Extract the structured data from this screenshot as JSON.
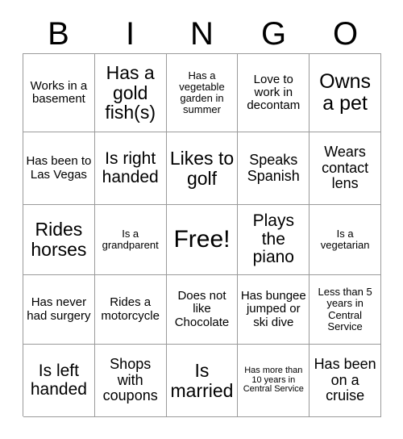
{
  "card": {
    "header_letters": [
      "B",
      "I",
      "N",
      "G",
      "O"
    ],
    "grid": {
      "rows": 5,
      "columns": 5,
      "border_color": "#9a9a9a",
      "background_color": "#ffffff",
      "text_color": "#000000"
    },
    "cells": [
      {
        "text": "Works in a basement",
        "size": "fs-sm",
        "column": "B",
        "row": 1
      },
      {
        "text": "Has a gold fish(s)",
        "size": "fs-xl",
        "column": "I",
        "row": 1
      },
      {
        "text": "Has a vegetable garden in summer",
        "size": "fs-xs",
        "column": "N",
        "row": 1
      },
      {
        "text": "Love to work in decontam",
        "size": "fs-sm",
        "column": "G",
        "row": 1
      },
      {
        "text": "Owns a pet",
        "size": "fs-xxl",
        "column": "O",
        "row": 1
      },
      {
        "text": "Has been to Las Vegas",
        "size": "fs-sm",
        "column": "B",
        "row": 2
      },
      {
        "text": "Is right handed",
        "size": "fs-lg",
        "column": "I",
        "row": 2
      },
      {
        "text": "Likes to golf",
        "size": "fs-xl",
        "column": "N",
        "row": 2
      },
      {
        "text": "Speaks Spanish",
        "size": "fs-md",
        "column": "G",
        "row": 2
      },
      {
        "text": "Wears contact lens",
        "size": "fs-md",
        "column": "O",
        "row": 2
      },
      {
        "text": "Rides horses",
        "size": "fs-xl",
        "column": "B",
        "row": 3
      },
      {
        "text": "Is a grandparent",
        "size": "fs-xs",
        "column": "I",
        "row": 3
      },
      {
        "text": "Free!",
        "size": "fs-free",
        "column": "N",
        "row": 3
      },
      {
        "text": "Plays the piano",
        "size": "fs-lg",
        "column": "G",
        "row": 3
      },
      {
        "text": "Is a vegetarian",
        "size": "fs-xs",
        "column": "O",
        "row": 3
      },
      {
        "text": "Has never had surgery",
        "size": "fs-sm",
        "column": "B",
        "row": 4
      },
      {
        "text": "Rides a motorcycle",
        "size": "fs-sm",
        "column": "I",
        "row": 4
      },
      {
        "text": "Does not like Chocolate",
        "size": "fs-sm",
        "column": "N",
        "row": 4
      },
      {
        "text": "Has bungee jumped or ski dive",
        "size": "fs-sm",
        "column": "G",
        "row": 4
      },
      {
        "text": "Less than 5 years in Central Service",
        "size": "fs-xs",
        "column": "O",
        "row": 4
      },
      {
        "text": "Is left handed",
        "size": "fs-lg",
        "column": "B",
        "row": 5
      },
      {
        "text": "Shops with coupons",
        "size": "fs-md",
        "column": "I",
        "row": 5
      },
      {
        "text": "Is married",
        "size": "fs-xl",
        "column": "N",
        "row": 5
      },
      {
        "text": "Has more than 10 years in Central Service",
        "size": "fs-xxs",
        "column": "G",
        "row": 5
      },
      {
        "text": "Has been on a cruise",
        "size": "fs-md",
        "column": "O",
        "row": 5
      }
    ],
    "free_space_index": 12
  }
}
